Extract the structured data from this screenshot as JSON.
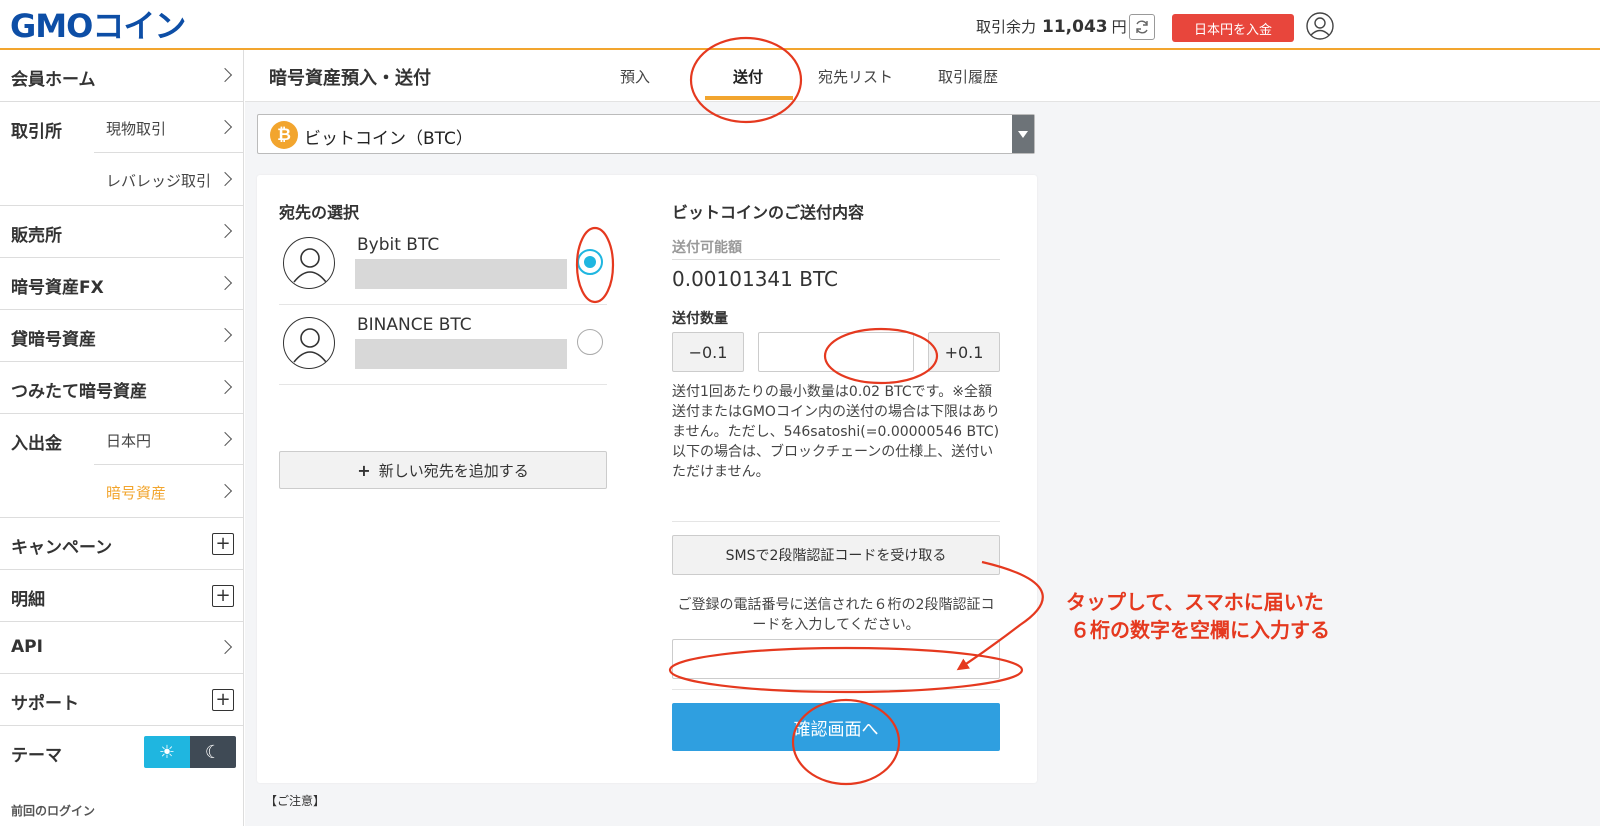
{
  "header": {
    "logo_text": "GMOコイン",
    "balance_label": "取引余力",
    "balance_value": "11,043",
    "balance_unit": "円",
    "deposit_button": "日本円を入金"
  },
  "sidebar": {
    "items": [
      {
        "label": "会員ホーム"
      },
      {
        "label": "取引所",
        "sub": [
          "現物取引",
          "レバレッジ取引"
        ]
      },
      {
        "label": "販売所"
      },
      {
        "label": "暗号資産FX"
      },
      {
        "label": "貸暗号資産"
      },
      {
        "label": "つみたて暗号資産"
      },
      {
        "label": "入出金",
        "sub": [
          "日本円",
          "暗号資産"
        ]
      },
      {
        "label": "キャンペーン"
      },
      {
        "label": "明細"
      },
      {
        "label": "API"
      },
      {
        "label": "サポート"
      },
      {
        "label": "テーマ"
      }
    ],
    "last_login": "前回のログイン"
  },
  "page": {
    "title": "暗号資産預入・送付",
    "tabs": [
      "預入",
      "送付",
      "宛先リスト",
      "取引履歴"
    ],
    "active_tab": "送付"
  },
  "coin": {
    "label": "ビットコイン（BTC）"
  },
  "destinations": {
    "title": "宛先の選択",
    "items": [
      {
        "name": "Bybit BTC",
        "selected": true
      },
      {
        "name": "BINANCE BTC",
        "selected": false
      }
    ],
    "add_button": "新しい宛先を追加する"
  },
  "send": {
    "title": "ビットコインのご送付内容",
    "available_label": "送付可能額",
    "available_value": "0.00101341 BTC",
    "qty_label": "送付数量",
    "minus_button": "−0.1",
    "plus_button": "+0.1",
    "note": "送付1回あたりの最小数量は0.02 BTCです。※全額送付またはGMOコイン内の送付の場合は下限はありません。ただし、546satoshi(=0.00000546 BTC)以下の場合は、ブロックチェーンの仕様上、送付いただけません。",
    "sms_button": "SMSで2段階認証コードを受け取る",
    "code_desc": "ご登録の電話番号に送信された６桁の2段階認証コードを入力してください。",
    "confirm_button": "確認画面へ"
  },
  "caution": "【ご注意】",
  "annotation": {
    "line1": "タップして、スマホに届いた",
    "line2": "６桁の数字を空欄に入力する",
    "color": "#e5391f"
  },
  "colors": {
    "accent": "#f2a52e",
    "primary_button": "#2f9fe0",
    "deposit_button": "#e8463c",
    "radio_selected": "#1fb6e0"
  }
}
